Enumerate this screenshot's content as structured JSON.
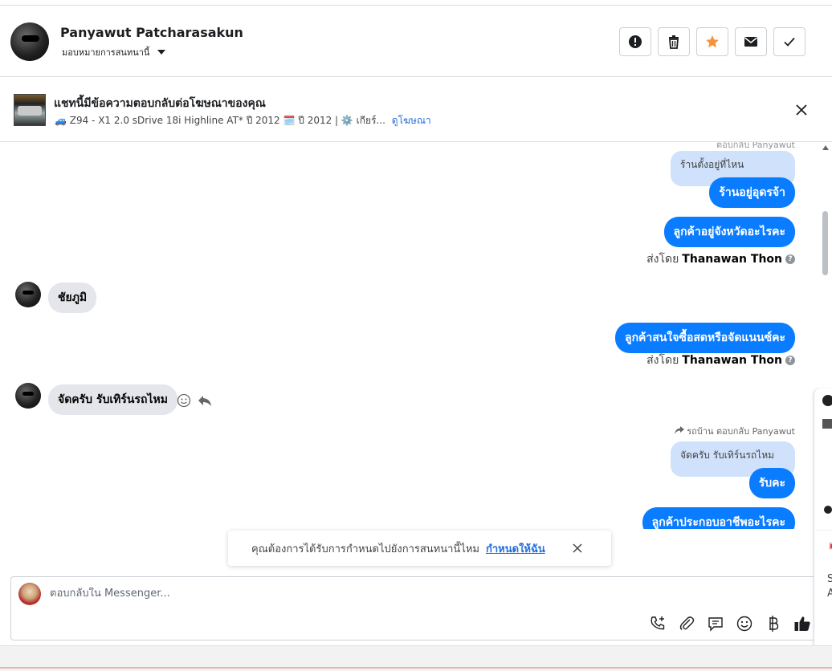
{
  "header": {
    "name": "Panyawut Patcharasakun",
    "assign_label": "มอบหมายการสนทนานี้",
    "actions": [
      "report",
      "delete",
      "star",
      "mark-unread",
      "done"
    ]
  },
  "ad": {
    "title": "แชทนี้มีข้อความตอบกลับต่อโฆษณาของคุณ",
    "subtitle": "🚙 Z94 - X1 2.0 sDrive 18i Highline AT* ปี 2012 🗓️ ปี 2012 | ⚙️ เกียร์...",
    "link": "ดูโฆษณา"
  },
  "conversation": {
    "top_meta": "ตอบกลับ Panyawut",
    "messages": {
      "quote1": "ร้านตั้งอยู่ที่ไหน",
      "out1": "ร้านอยู่อุดรจ้า",
      "out2": "ลูกค้าอยู่จังหวัดอะไรคะ",
      "sentby_prefix": "ส่งโดย",
      "sentby_name": "Thanawan Thon",
      "in1": "ชัยภูมิ",
      "out3": "ลูกค้าสนใจซื้อสดหรือจัดแนนซ์คะ",
      "in2": "จัดครับ รับเทิร์นรถไหม",
      "reply_meta": "รถบ้าน ตอบกลับ Panyawut",
      "quote2": "จัดครับ รับเทิร์นรถไหม",
      "out4": "รับคะ",
      "out5": "ลูกค้าประกอบอาชีพอะไรคะ"
    }
  },
  "toast": {
    "text": "คุณต้องการได้รับการกำหนดไปยังการสนทนานี้ไหม",
    "link": "กำหนดให้ฉัน"
  },
  "composer": {
    "placeholder": "ตอบกลับใน Messenger...",
    "tools": [
      "call-add-icon",
      "attach-icon",
      "saved-reply-icon",
      "emoji-icon",
      "baht-icon",
      "like-icon"
    ]
  },
  "side_panel": {
    "text_line1": "S",
    "text_line2": "A"
  },
  "colors": {
    "accent": "#0a7cff",
    "quote_bg": "#cfe1fb",
    "incoming_bg": "#e4e6eb",
    "star": "#f7923b",
    "link": "#216fdb"
  }
}
